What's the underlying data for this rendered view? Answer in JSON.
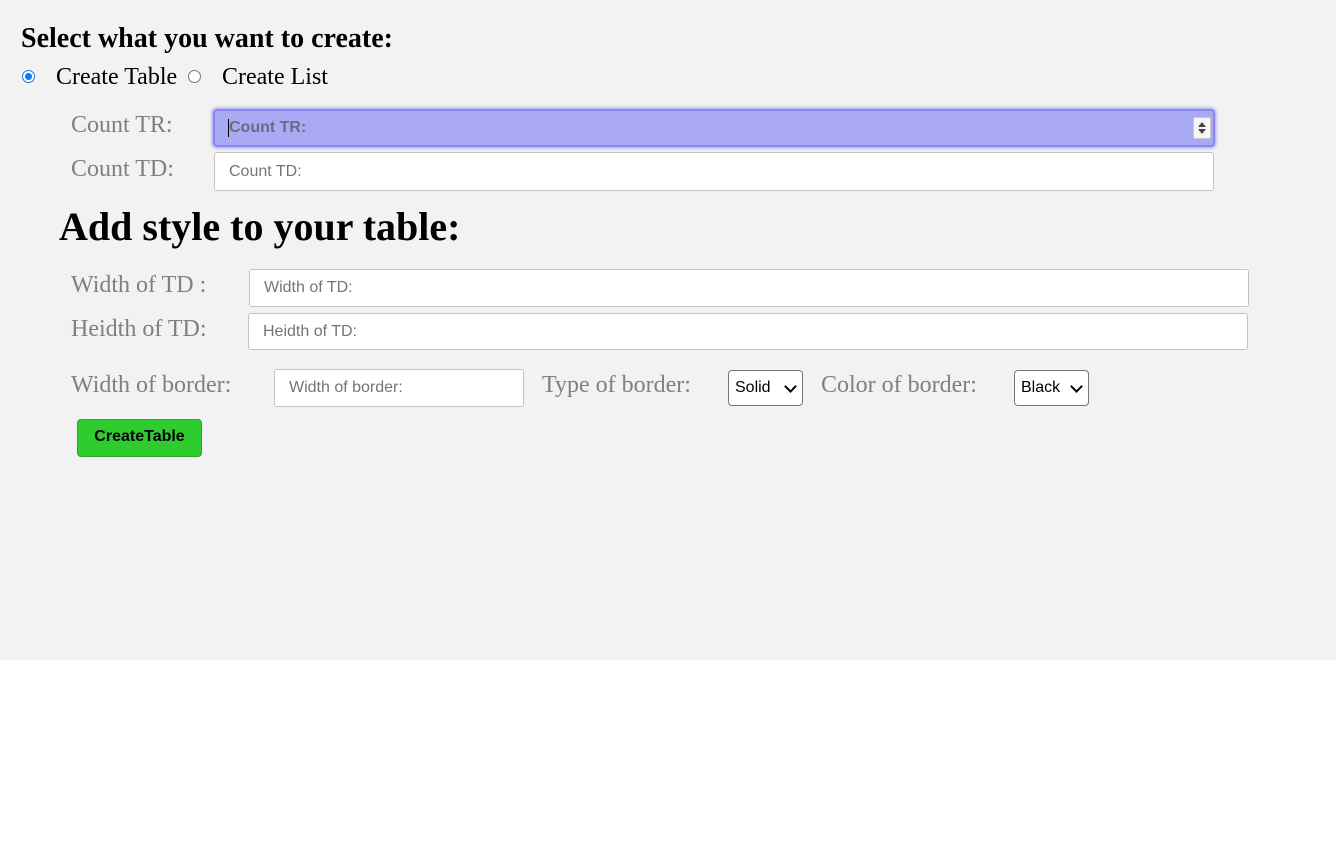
{
  "heading": "Select what you want to create:",
  "radios": [
    {
      "label": "Create Table",
      "checked": true
    },
    {
      "label": "Create List",
      "checked": false
    }
  ],
  "count_tr": {
    "label": "Count TR:",
    "placeholder": "Count TR:",
    "focused": true
  },
  "count_td": {
    "label": "Count TD:",
    "placeholder": "Count TD:"
  },
  "style_heading": "Add style to your table:",
  "width_td": {
    "label": "Width of TD :",
    "placeholder": "Width of TD:"
  },
  "height_td": {
    "label": "Heidth of TD:",
    "placeholder": "Heidth of TD:"
  },
  "border_width": {
    "label": "Width of border:",
    "placeholder": "Width of border:"
  },
  "border_type": {
    "label": "Type of border:",
    "selected": "Solid"
  },
  "border_color": {
    "label": "Color of border:",
    "selected": "Black"
  },
  "create_button": "CreateTable",
  "colors": {
    "panel_bg": "#f2f2f2",
    "focus_bg": "#aaa9f4",
    "button_bg": "#2ecc2e",
    "label_gray": "#808080",
    "radio_accent": "#1a73e8"
  }
}
